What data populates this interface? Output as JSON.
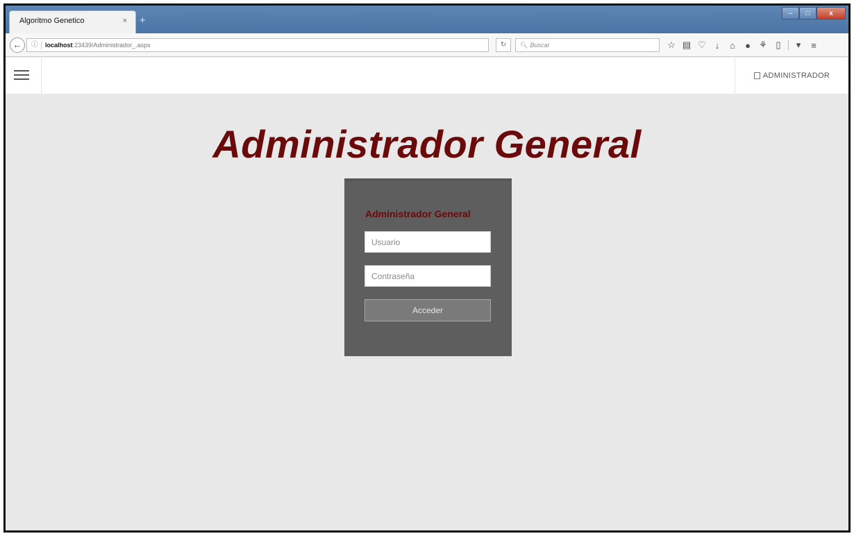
{
  "browser": {
    "tab_title": "Algoritmo Genetico",
    "tab_close": "×",
    "new_tab": "+",
    "url_host": "localhost",
    "url_rest": ":23439/Administrador_.aspx",
    "search_placeholder": "Buscar",
    "window_controls": {
      "minimize": "–",
      "maximize": "□",
      "close": "x"
    }
  },
  "header": {
    "admin_label": "ADMINISTRADOR"
  },
  "main": {
    "page_title": "Administrador General",
    "login": {
      "heading": "Administrador General",
      "username_placeholder": "Usuario",
      "password_placeholder": "Contraseña",
      "submit_label": "Acceder"
    }
  },
  "colors": {
    "title": "#6a0a0a",
    "panel": "#5e5e5e",
    "page_background": "#e8e8e8",
    "button": "#7a7a7a"
  }
}
